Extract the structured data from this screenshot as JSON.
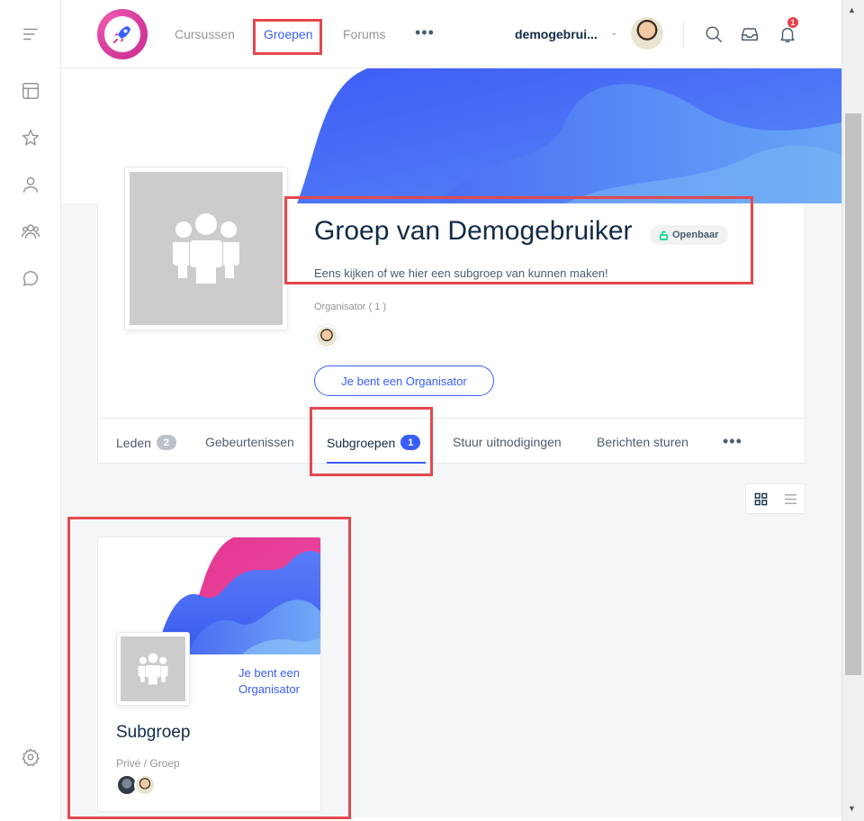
{
  "nav": {
    "items": [
      {
        "label": "Cursussen"
      },
      {
        "label": "Groepen"
      },
      {
        "label": "Forums"
      }
    ],
    "more": "•••"
  },
  "user": {
    "name": "demogebrui...",
    "notifications": "1"
  },
  "group": {
    "title": "Groep van Demogebruiker",
    "privacy": "Openbaar",
    "description": "Eens kijken of we hier een subgroep van kunnen maken!",
    "organizer_label": "Organisator ( 1 )",
    "role_button": "Je bent een Organisator"
  },
  "tabs": [
    {
      "label": "Leden",
      "count": "2"
    },
    {
      "label": "Gebeurtenissen"
    },
    {
      "label": "Subgroepen",
      "count": "1"
    },
    {
      "label": "Stuur uitnodigingen"
    },
    {
      "label": "Berichten sturen"
    }
  ],
  "tabs_more": "•••",
  "subgroup": {
    "role": "Je bent een Organisator",
    "name": "Subgroep",
    "meta": "Privé / Groep"
  },
  "colors": {
    "accent": "#385dff",
    "highlight": "#e5484d",
    "badge_red": "#ef3e46",
    "public_green": "#1cd991"
  }
}
